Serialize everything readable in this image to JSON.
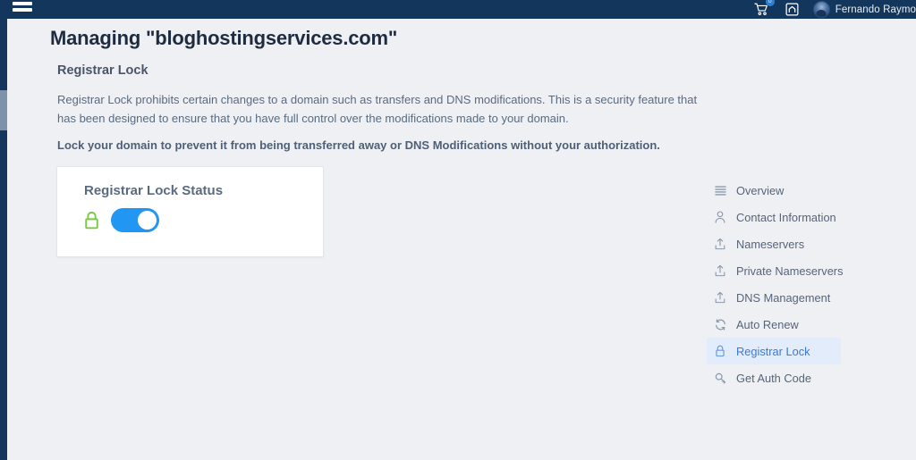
{
  "topbar": {
    "menu_icon": "hamburger-icon",
    "cart_icon": "shopping-cart-icon",
    "cart_badge": "0",
    "store_icon": "storefront-icon",
    "avatar_icon": "user-avatar",
    "username": "Fernando Raymo"
  },
  "page": {
    "title": "Managing \"bloghostingservices.com\"",
    "section_title": "Registrar Lock",
    "paragraph": "Registrar Lock prohibits certain changes to a domain such as transfers and DNS modifications. This is a security feature that has been designed to ensure that you have full control over the modifications made to your domain.",
    "paragraph_bold": "Lock your domain to prevent it from being transferred away or DNS Modifications without your authorization."
  },
  "card": {
    "title": "Registrar Lock Status",
    "lock_icon": "padlock-closed-icon",
    "lock_color": "#7ac943",
    "toggle_state": "on",
    "toggle_color": "#2196f3"
  },
  "sidemenu": {
    "items": [
      {
        "label": "Overview",
        "icon": "list-lines-icon",
        "active": false
      },
      {
        "label": "Contact Information",
        "icon": "person-icon",
        "active": false
      },
      {
        "label": "Nameservers",
        "icon": "upload-icon",
        "active": false
      },
      {
        "label": "Private Nameservers",
        "icon": "upload-icon",
        "active": false
      },
      {
        "label": "DNS Management",
        "icon": "upload-icon",
        "active": false
      },
      {
        "label": "Auto Renew",
        "icon": "refresh-icon",
        "active": false
      },
      {
        "label": "Registrar Lock",
        "icon": "padlock-icon",
        "active": true
      },
      {
        "label": "Get Auth Code",
        "icon": "key-icon",
        "active": false
      }
    ],
    "active_bg": "#e2ecfb",
    "active_color": "#3c78d8"
  },
  "colors": {
    "topbar_bg": "#13365d",
    "page_bg": "#eef0f4",
    "card_bg": "#ffffff",
    "title_color": "#1f2c40",
    "text_color": "#5a6b80"
  }
}
